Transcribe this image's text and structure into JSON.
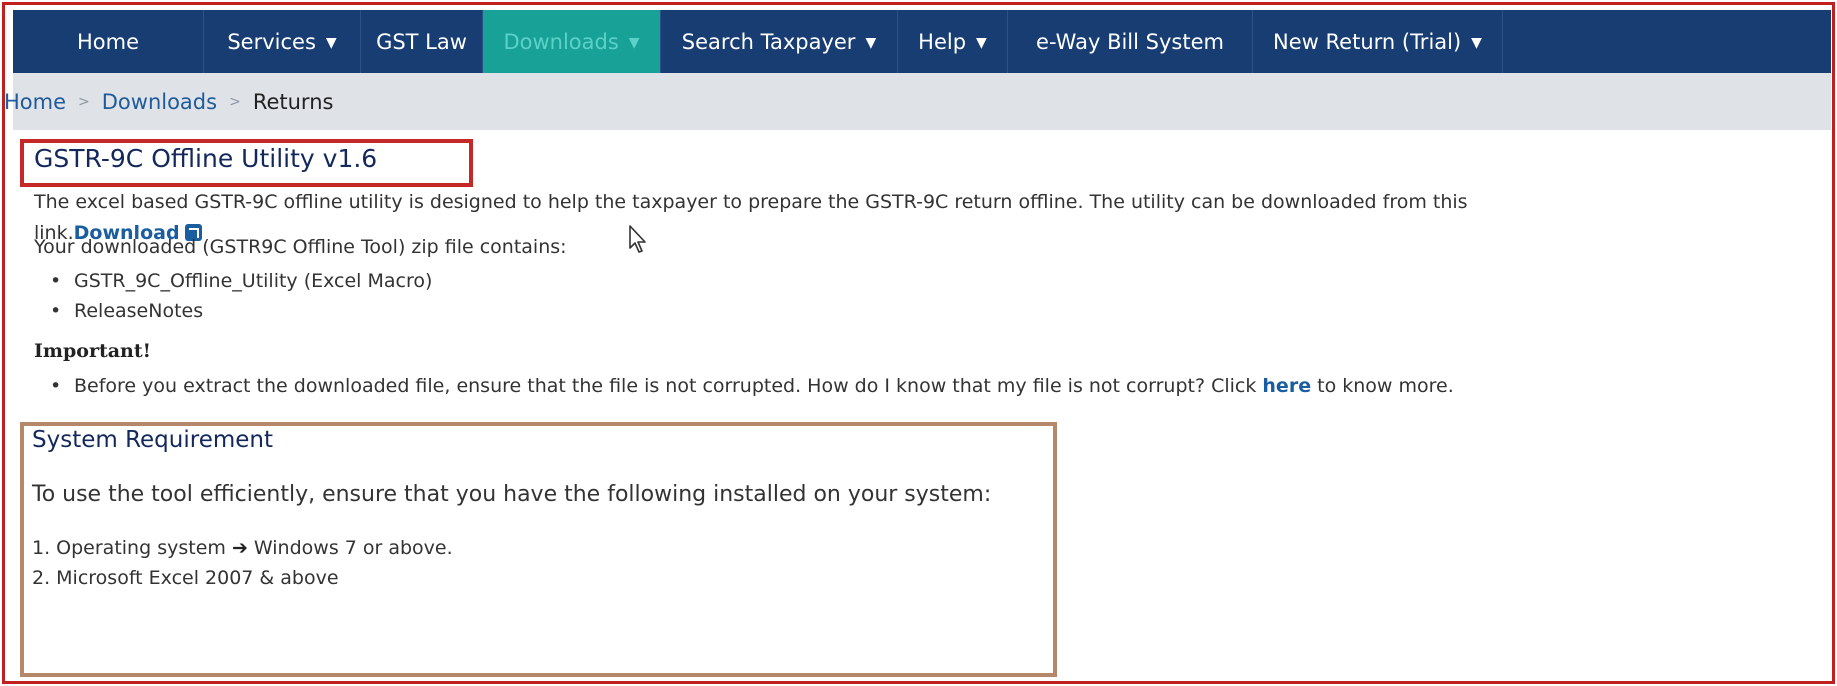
{
  "nav": {
    "items": [
      {
        "label": "Home",
        "caret": false
      },
      {
        "label": "Services",
        "caret": true
      },
      {
        "label": "GST Law",
        "caret": false
      },
      {
        "label": "Downloads",
        "caret": true
      },
      {
        "label": "Search Taxpayer",
        "caret": true
      },
      {
        "label": "Help",
        "caret": true
      },
      {
        "label": "e-Way Bill System",
        "caret": false
      },
      {
        "label": "New Return (Trial)",
        "caret": true
      }
    ],
    "active": "Downloads"
  },
  "breadcrumb": {
    "home": "Home",
    "downloads": "Downloads",
    "current": "Returns"
  },
  "page": {
    "title": "GSTR-9C Offline Utility v1.6",
    "intro_line1": "The excel based GSTR-9C offline utility is designed to help the taxpayer to prepare the GSTR-9C return offline. The utility can be downloaded from this",
    "intro_line2_prefix": "link.",
    "download_link": "Download",
    "zip_contains": "Your downloaded (GSTR9C Offline Tool) zip file contains:",
    "zip_items": [
      "GSTR_9C_Offline_Utility (Excel Macro)",
      "ReleaseNotes"
    ],
    "important_heading": "Important!",
    "important_prefix": "Before you extract the downloaded file, ensure that the file is not corrupted. How do I know that my file is not corrupt? Click ",
    "important_link": "here",
    "important_suffix": " to know more."
  },
  "system": {
    "title": "System Requirement",
    "intro": "To use the tool efficiently, ensure that you have the following installed on your system:",
    "req1_prefix": "1. Operating system ",
    "req1_arrow": "➔",
    "req1_suffix": " Windows 7 or above.",
    "req2": "2. Microsoft Excel 2007 & above"
  },
  "colors": {
    "nav_bg": "#183d73",
    "nav_active_bg": "#17a197",
    "highlight_red": "#c62827",
    "highlight_brown": "#b5886a",
    "link": "#1b5ea0"
  },
  "icons": {
    "external_link": "external-link-icon",
    "caret": "caret-down-icon",
    "breadcrumb_sep": "chevron-right-icon",
    "cursor": "mouse-cursor-icon"
  }
}
